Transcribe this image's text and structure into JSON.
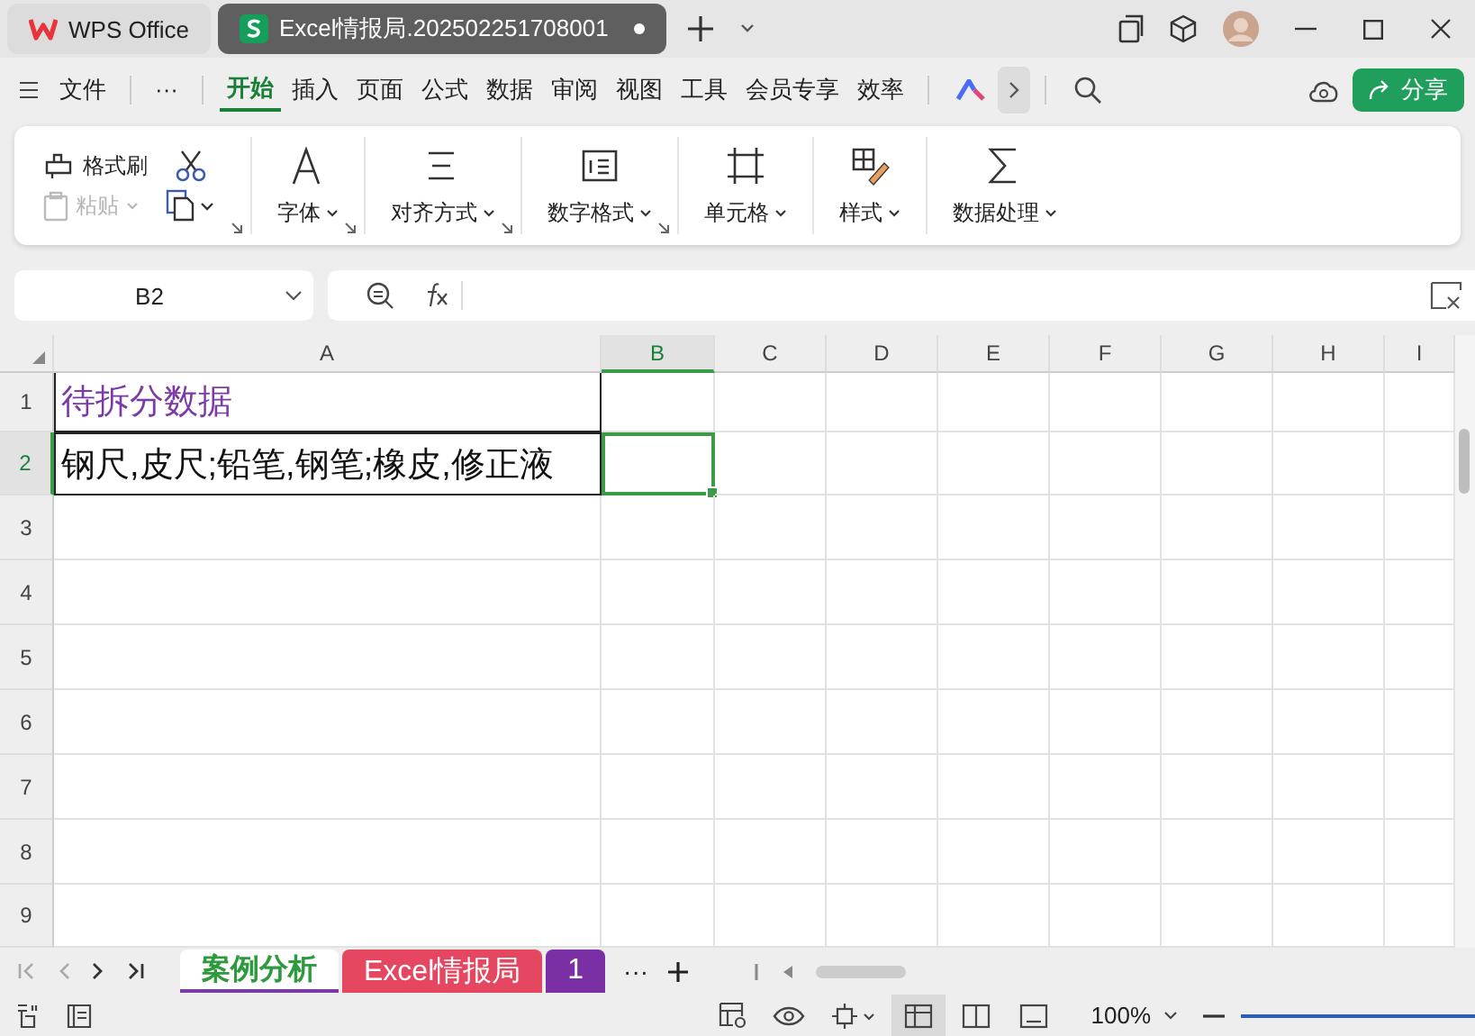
{
  "tabs": [
    {
      "kind": "home",
      "label": "WPS Office",
      "selected": false
    },
    {
      "kind": "doc",
      "label": "Excel情报局.202502251708001",
      "selected": true,
      "modified": true
    }
  ],
  "menu": {
    "file": "文件",
    "more": "···",
    "items": [
      {
        "label": "开始",
        "selected": true
      },
      {
        "label": "插入",
        "selected": false
      },
      {
        "label": "页面",
        "selected": false
      },
      {
        "label": "公式",
        "selected": false
      },
      {
        "label": "数据",
        "selected": false
      },
      {
        "label": "审阅",
        "selected": false
      },
      {
        "label": "视图",
        "selected": false
      },
      {
        "label": "工具",
        "selected": false
      },
      {
        "label": "会员专享",
        "selected": false
      },
      {
        "label": "效率",
        "selected": false
      }
    ],
    "share": "分享"
  },
  "ribbon": {
    "clipboard": {
      "format_painter": "格式刷",
      "paste": "粘贴",
      "paste_disabled": true,
      "launcher": true
    },
    "groups": [
      {
        "kind": "font",
        "label": "字体",
        "launcher": true
      },
      {
        "kind": "align",
        "label": "对齐方式",
        "launcher": true
      },
      {
        "kind": "number",
        "label": "数字格式",
        "launcher": true
      },
      {
        "kind": "cell",
        "label": "单元格"
      },
      {
        "kind": "style",
        "label": "样式"
      },
      {
        "kind": "data",
        "label": "数据处理"
      }
    ]
  },
  "formula_bar": {
    "cell_ref": "B2"
  },
  "sheet": {
    "columns": [
      {
        "label": "A",
        "selected": false
      },
      {
        "label": "B",
        "selected": true
      },
      {
        "label": "C",
        "selected": false
      },
      {
        "label": "D",
        "selected": false
      },
      {
        "label": "E",
        "selected": false
      },
      {
        "label": "F",
        "selected": false
      },
      {
        "label": "G",
        "selected": false
      },
      {
        "label": "H",
        "selected": false
      },
      {
        "label": "I",
        "selected": false
      }
    ],
    "rows": [
      {
        "label": "1",
        "selected": false,
        "cells": [
          {
            "kind": "title",
            "text": "待拆分数据"
          }
        ]
      },
      {
        "label": "2",
        "selected": true,
        "cells": [
          {
            "kind": "body",
            "text": "钢尺,皮尺;铅笔,钢笔;橡皮,修正液"
          }
        ]
      },
      {
        "label": "3",
        "selected": false,
        "cells": []
      },
      {
        "label": "4",
        "selected": false,
        "cells": []
      },
      {
        "label": "5",
        "selected": false,
        "cells": []
      },
      {
        "label": "6",
        "selected": false,
        "cells": []
      },
      {
        "label": "7",
        "selected": false,
        "cells": []
      },
      {
        "label": "8",
        "selected": false,
        "cells": []
      },
      {
        "label": "9",
        "selected": false,
        "cells": []
      }
    ]
  },
  "sheet_tabs": [
    {
      "label": "案例分析",
      "selected": true,
      "color": "#ffffff"
    },
    {
      "label": "Excel情报局",
      "selected": false,
      "color": "#e4475f"
    },
    {
      "label": "1",
      "selected": false,
      "color": "#7b2fa4"
    }
  ],
  "sheet_tab_more": "···",
  "status_bar": {
    "zoom": "100%",
    "view": [
      {
        "kind": "normal",
        "selected": true
      },
      {
        "kind": "split",
        "selected": false
      },
      {
        "kind": "page",
        "selected": false
      }
    ]
  }
}
